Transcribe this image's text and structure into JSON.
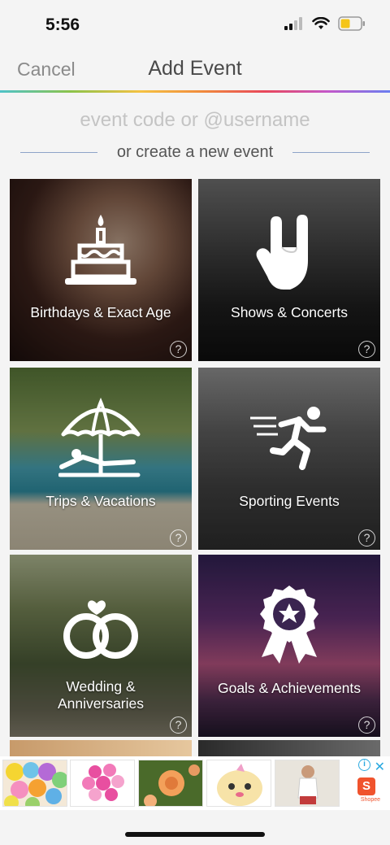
{
  "status_bar": {
    "time": "5:56"
  },
  "nav": {
    "cancel_label": "Cancel",
    "title": "Add Event"
  },
  "search": {
    "placeholder": "event code or @username",
    "value": ""
  },
  "divider_text": "or create a new event",
  "categories": [
    {
      "label": "Birthdays & Exact Age",
      "icon": "birthday-cake-icon",
      "help": "?"
    },
    {
      "label": "Shows & Concerts",
      "icon": "rock-hand-icon",
      "help": "?"
    },
    {
      "label": "Trips & Vacations",
      "icon": "beach-umbrella-icon",
      "help": "?"
    },
    {
      "label": "Sporting Events",
      "icon": "runner-icon",
      "help": "?"
    },
    {
      "label_line1": "Wedding &",
      "label_line2": "Anniversaries",
      "icon": "wedding-rings-icon",
      "help": "?"
    },
    {
      "label": "Goals & Achievements",
      "icon": "award-ribbon-icon",
      "help": "?"
    }
  ],
  "ad": {
    "close": "✕",
    "info": "i",
    "brand_letter": "S",
    "brand": "Shopee"
  },
  "colors": {
    "accent_line": "#8ea4c8",
    "battery": "#f5c518"
  }
}
